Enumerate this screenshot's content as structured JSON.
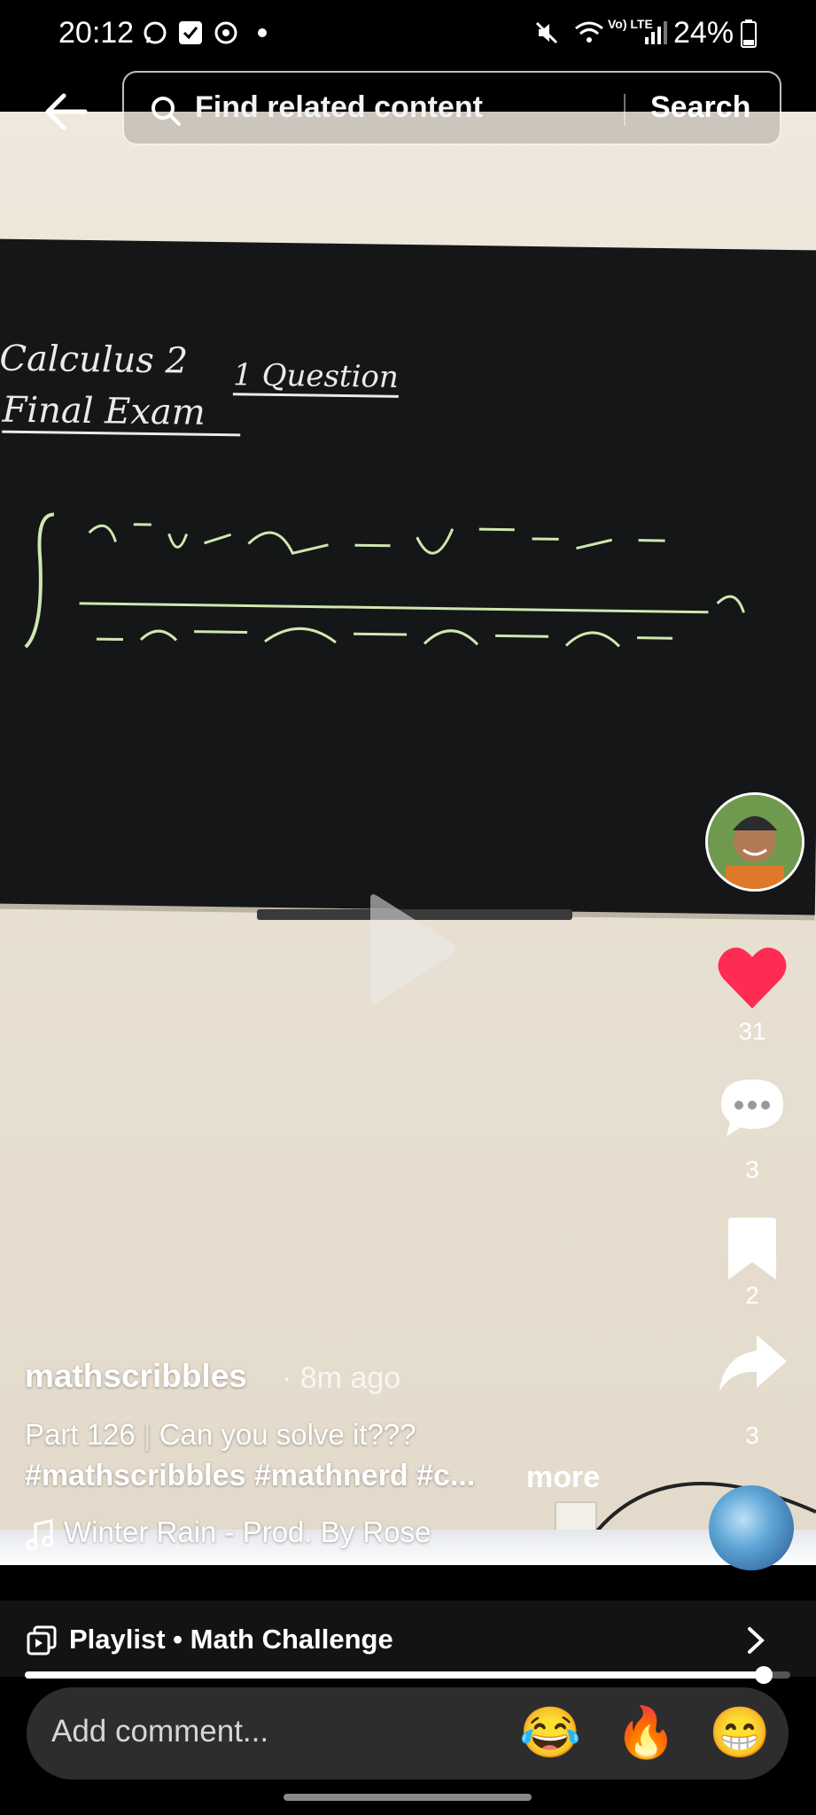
{
  "status_bar": {
    "time": "20:12",
    "battery": "24%",
    "network": "Vo) LTE",
    "signal_wifi_label": "6"
  },
  "search": {
    "placeholder": "Find related content",
    "button_label": "Search"
  },
  "video": {
    "blackboard_text": {
      "line1": "Calculus 2",
      "line2": "Final Exam",
      "note": "1 Question"
    }
  },
  "actions": {
    "likes": "31",
    "comments": "3",
    "saves": "2",
    "shares": "3"
  },
  "post": {
    "author": "mathscribbles",
    "time_ago": "· 8m ago",
    "part": "Part 126",
    "divider": "|",
    "caption": "Can you solve it???",
    "hashtags": "#mathscribbles #mathnerd #c...",
    "more_label": "more",
    "music": "Winter Rain - Prod. By Rose"
  },
  "playlist": {
    "label": "Playlist • Math Challenge",
    "progress": 0.96
  },
  "comment_bar": {
    "placeholder": "Add comment...",
    "emojis": [
      "😂",
      "🔥",
      "😁"
    ]
  },
  "colors": {
    "like_red": "#fe2c55",
    "background": "#000000",
    "chalk": "#cfe7b0"
  }
}
